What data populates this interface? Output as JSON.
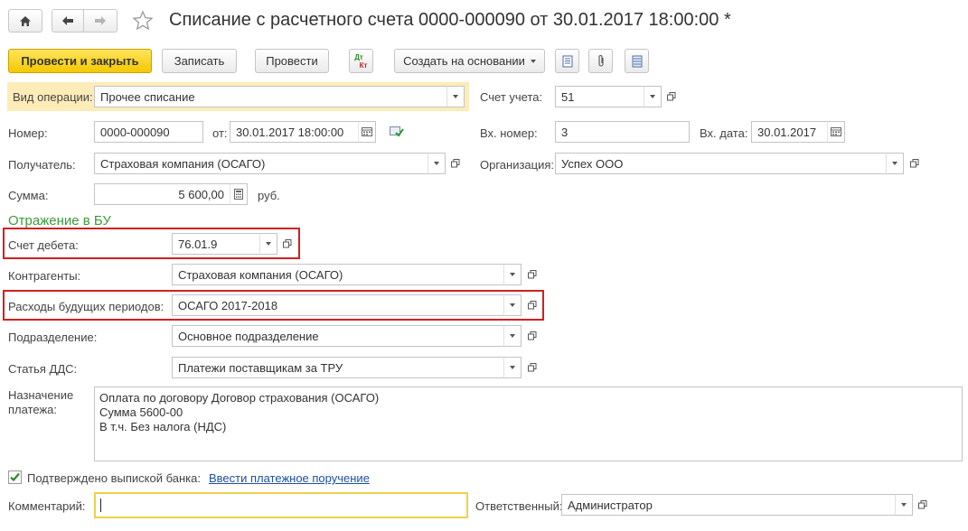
{
  "window": {
    "title": "Списание с расчетного счета 0000-000090 от 30.01.2017 18:00:00 *"
  },
  "toolbar": {
    "post_and_close": "Провести и закрыть",
    "save": "Записать",
    "post": "Провести",
    "dtkt_icon_top": "Дт",
    "dtkt_icon_bottom": "Кт",
    "create_based_on": "Создать на основании"
  },
  "form": {
    "operation_type": {
      "label": "Вид операции:",
      "value": "Прочее списание"
    },
    "account": {
      "label": "Счет учета:",
      "value": "51"
    },
    "number": {
      "label": "Номер:",
      "value": "0000-000090"
    },
    "date": {
      "label": "от:",
      "value": "30.01.2017 18:00:00"
    },
    "in_number": {
      "label": "Вх. номер:",
      "value": "3"
    },
    "in_date": {
      "label": "Вх. дата:",
      "value": "30.01.2017"
    },
    "recipient": {
      "label": "Получатель:",
      "value": "Страховая компания (ОСАГО)"
    },
    "organization": {
      "label": "Организация:",
      "value": "Успех ООО"
    },
    "amount": {
      "label": "Сумма:",
      "value": "5 600,00",
      "unit": "руб."
    }
  },
  "accounting": {
    "section_title": "Отражение в БУ",
    "debit_account": {
      "label": "Счет дебета:",
      "value": "76.01.9"
    },
    "counterparties": {
      "label": "Контрагенты:",
      "value": "Страховая компания (ОСАГО)"
    },
    "future_expenses": {
      "label": "Расходы будущих периодов:",
      "value": "ОСАГО 2017-2018"
    },
    "department": {
      "label": "Подразделение:",
      "value": "Основное подразделение"
    },
    "cash_flow_item": {
      "label": "Статья ДДС:",
      "value": "Платежи поставщикам за ТРУ"
    }
  },
  "payment_purpose": {
    "label_line1": "Назначение",
    "label_line2": "платежа:",
    "lines": [
      "Оплата по договору Договор страхования (ОСАГО)",
      "Сумма 5600-00",
      "В т.ч. Без налога (НДС)"
    ]
  },
  "footer": {
    "bank_confirmed_label": "Подтверждено выпиской банка:",
    "bank_confirmed_checked": true,
    "enter_payment_order_link": "Ввести платежное поручение",
    "comment_label": "Комментарий:",
    "comment_value": "",
    "responsible_label": "Ответственный:",
    "responsible_value": "Администратор"
  },
  "colors": {
    "primary_button": "#f5c800",
    "highlight_box": "#d21f1f",
    "section_title": "#3c9a3c",
    "link": "#1f4fa0",
    "active_row_bg": "#fdecb8"
  }
}
